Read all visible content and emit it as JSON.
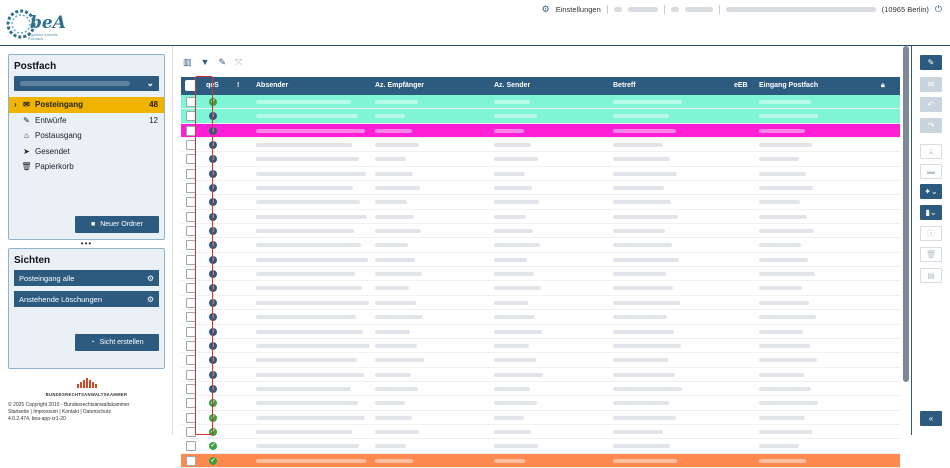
{
  "app": {
    "logo_text": "beA",
    "logo_sub": "Digitales Anwalts Postfach"
  },
  "topnav": {
    "settings_icon": "gear-icon",
    "settings_label": "Einstellungen",
    "location": "(10965 Berlin)",
    "power_icon": "power-icon"
  },
  "sidebar": {
    "postfach_title": "Postfach",
    "folders": [
      {
        "label": "Posteingang",
        "count": "48",
        "icon": "mail-icon",
        "active": true
      },
      {
        "label": "Entwürfe",
        "count": "12",
        "icon": "edit-icon"
      },
      {
        "label": "Postausgang",
        "count": "",
        "icon": "outbox-icon"
      },
      {
        "label": "Gesendet",
        "count": "",
        "icon": "send-icon"
      },
      {
        "label": "Papierkorb",
        "count": "",
        "icon": "trash-icon"
      }
    ],
    "new_folder_label": "Neuer Ordner",
    "sichten_title": "Sichten",
    "views": [
      {
        "label": "Posteingang alle"
      },
      {
        "label": "Anstehende Löschungen"
      }
    ],
    "create_view_label": "Sicht erstellen"
  },
  "footer": {
    "org": "BUNDESRECHTSANWALTSKAMMER",
    "copyright": "© 2025 Copyright 2015 - Bundesrechtsanwaltskammer",
    "links": "Startseite | Impressum | Kontakt | Datenschutz",
    "version": "4.0.2.474, bea-app-rz1-20"
  },
  "table": {
    "headers": {
      "qes": "qeS",
      "priority": "!",
      "absender": "Absender",
      "az_empfaenger": "Az. Empfänger",
      "az_sender": "Az. Sender",
      "betreff": "Betreff",
      "eeb": "eEB",
      "eingang": "Eingang Postfach"
    },
    "rows": [
      {
        "status": "ok",
        "color": "#7ff5d6"
      },
      {
        "status": "info",
        "color": "#7ff5d6"
      },
      {
        "status": "info",
        "color": "#ff1fd6"
      },
      {
        "status": "info",
        "color": ""
      },
      {
        "status": "info",
        "color": ""
      },
      {
        "status": "info",
        "color": ""
      },
      {
        "status": "info",
        "color": ""
      },
      {
        "status": "info",
        "color": ""
      },
      {
        "status": "info",
        "color": ""
      },
      {
        "status": "info",
        "color": ""
      },
      {
        "status": "info",
        "color": ""
      },
      {
        "status": "info",
        "color": ""
      },
      {
        "status": "info",
        "color": ""
      },
      {
        "status": "info",
        "color": ""
      },
      {
        "status": "info",
        "color": ""
      },
      {
        "status": "info",
        "color": ""
      },
      {
        "status": "info",
        "color": ""
      },
      {
        "status": "info",
        "color": ""
      },
      {
        "status": "info",
        "color": ""
      },
      {
        "status": "info",
        "color": ""
      },
      {
        "status": "info",
        "color": ""
      },
      {
        "status": "ok",
        "color": ""
      },
      {
        "status": "ok",
        "color": ""
      },
      {
        "status": "ok",
        "color": ""
      },
      {
        "status": "ok",
        "color": ""
      },
      {
        "status": "ok",
        "color": "#ff8a50"
      }
    ]
  },
  "colors": {
    "primary": "#2d5b80",
    "active": "#f0b400",
    "qes_marker": "#d93030"
  }
}
